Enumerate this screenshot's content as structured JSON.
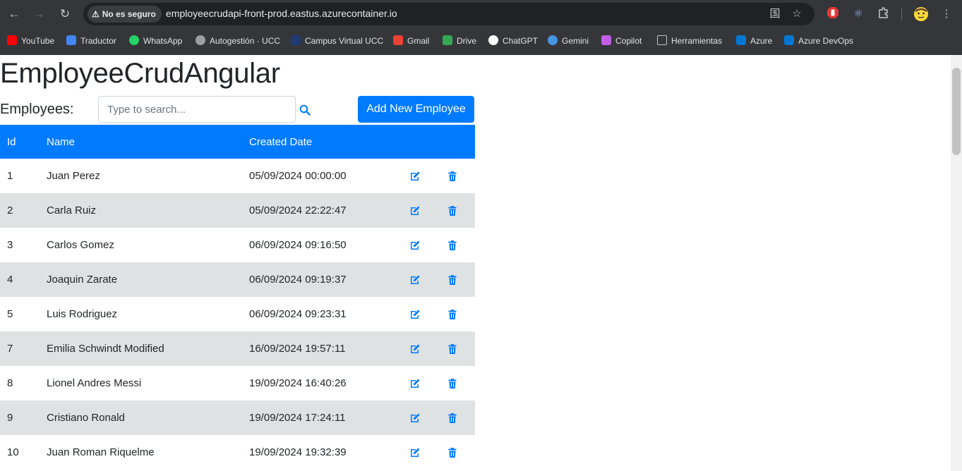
{
  "browser": {
    "security_label": "No es seguro",
    "url": "employeecrudapi-front-prod.eastus.azurecontainer.io"
  },
  "bookmarks": [
    {
      "label": "YouTube",
      "icon": "youtube-icon",
      "color": "#ff0000"
    },
    {
      "label": "Traductor",
      "icon": "translate-icon",
      "color": "#4285f4"
    },
    {
      "label": "WhatsApp",
      "icon": "whatsapp-icon",
      "color": "#25d366"
    },
    {
      "label": "Autogestión · UCC",
      "icon": "globe-icon",
      "color": "#9aa0a6"
    },
    {
      "label": "Campus Virtual UCC",
      "icon": "campus-icon",
      "color": "#1f3b73"
    },
    {
      "label": "Gmail",
      "icon": "gmail-icon",
      "color": "#ea4335"
    },
    {
      "label": "Drive",
      "icon": "drive-icon",
      "color": "#34a853"
    },
    {
      "label": "ChatGPT",
      "icon": "chatgpt-icon",
      "color": "#ffffff"
    },
    {
      "label": "Gemini",
      "icon": "gemini-icon",
      "color": "#4796e3"
    },
    {
      "label": "Copilot",
      "icon": "copilot-icon",
      "color": "#c15ee6"
    },
    {
      "label": "Herramientas",
      "icon": "folder-icon",
      "color": "#c4c7c5"
    },
    {
      "label": "Azure",
      "icon": "azure-icon",
      "color": "#0078d4"
    },
    {
      "label": "Azure DevOps",
      "icon": "azure-devops-icon",
      "color": "#0078d4"
    }
  ],
  "app": {
    "title": "EmployeeCrudAngular",
    "employees_label": "Employees:",
    "search_placeholder": "Type to search...",
    "add_button": "Add New Employee",
    "accent_color": "#007bff"
  },
  "table": {
    "headers": [
      "Id",
      "Name",
      "Created Date"
    ],
    "rows": [
      {
        "id": "1",
        "name": "Juan Perez",
        "created": "05/09/2024 00:00:00"
      },
      {
        "id": "2",
        "name": "Carla Ruiz",
        "created": "05/09/2024 22:22:47"
      },
      {
        "id": "3",
        "name": "Carlos Gomez",
        "created": "06/09/2024 09:16:50"
      },
      {
        "id": "4",
        "name": "Joaquin Zarate",
        "created": "06/09/2024 09:19:37"
      },
      {
        "id": "5",
        "name": "Luis Rodriguez",
        "created": "06/09/2024 09:23:31"
      },
      {
        "id": "7",
        "name": "Emilia Schwindt Modified",
        "created": "16/09/2024 19:57:11"
      },
      {
        "id": "8",
        "name": "Lionel Andres Messi",
        "created": "19/09/2024 16:40:26"
      },
      {
        "id": "9",
        "name": "Cristiano Ronald",
        "created": "19/09/2024 17:24:11"
      },
      {
        "id": "10",
        "name": "Juan Roman Riquelme",
        "created": "19/09/2024 19:32:39"
      }
    ]
  }
}
